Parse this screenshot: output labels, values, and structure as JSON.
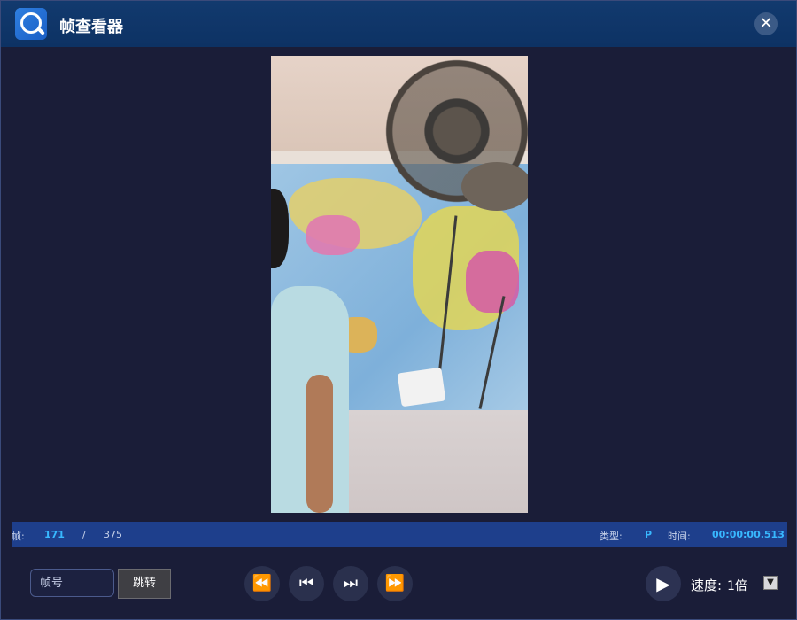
{
  "window": {
    "title": "帧查看器"
  },
  "info": {
    "frame_label": "帧:",
    "frame_current": "171",
    "frame_sep": "/",
    "frame_total": "375",
    "type_label": "类型:",
    "type_value": "P",
    "time_label": "时间:",
    "time_value": "00:00:00.513"
  },
  "controls": {
    "frame_input_placeholder": "帧号",
    "jump_label": "跳转",
    "speed_label": "速度:",
    "speed_value": "1倍"
  },
  "colors": {
    "titlebar": "#0d3264",
    "accent": "#38b8ff",
    "infobar": "#1e3f8c"
  }
}
